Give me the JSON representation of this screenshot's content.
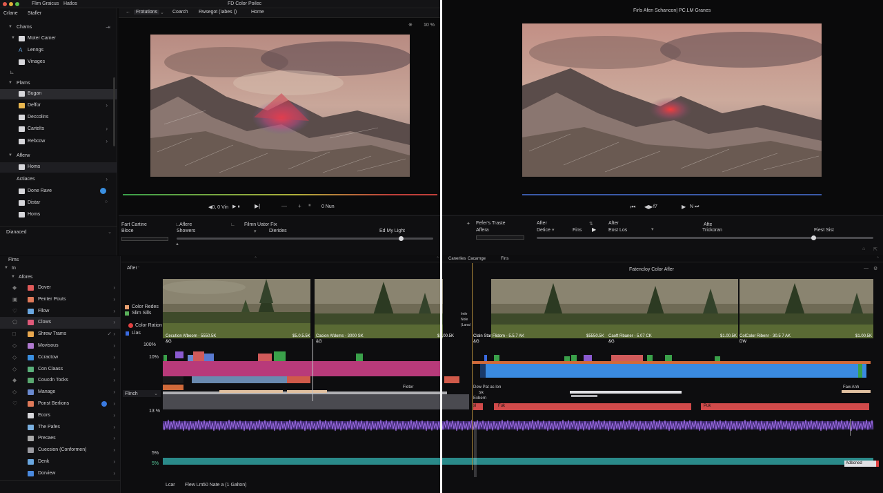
{
  "titlebar": {
    "app_name": "Flim Graicus",
    "menu_1": "Hatlos",
    "title": "FD Color Poilec"
  },
  "toolbar_left": {
    "item_1": "Crlane",
    "item_2": "Stafler",
    "tab_active": "Frotutions",
    "tab_2": "Coarch",
    "tab_3": "Rwsegot (Iabes ()",
    "tab_4": "Home",
    "zoom": "10 %",
    "zoom_prefix": "※"
  },
  "viewer_right": {
    "title": "Firls Afen Schancon| PC.LM Granes"
  },
  "sidebar": {
    "groups": [
      {
        "label": "Chams"
      },
      {
        "label": "Plams"
      },
      {
        "label": "Aflerw"
      },
      {
        "label": "Actiaces"
      }
    ],
    "items": [
      {
        "label": "Moter Camer"
      },
      {
        "label": "Lenngs"
      },
      {
        "label": "Vinages"
      },
      {
        "label": "Bugan"
      },
      {
        "label": "Deffor"
      },
      {
        "label": "Deccolins"
      },
      {
        "label": "Cartelts"
      },
      {
        "label": "Rebcow"
      },
      {
        "label": "Homs"
      },
      {
        "label": "Done Rave"
      },
      {
        "label": "Distar"
      },
      {
        "label": "Homs"
      }
    ],
    "footer": "Dianaced"
  },
  "transport_left": {
    "timecode": "◀0, 0 Vin",
    "end": "0 Nun"
  },
  "transport_right": {
    "frame": "f7"
  },
  "controls_left": {
    "label_1": "Fart Cartine",
    "label_1b": "Bloce",
    "label_2": "Aflere",
    "label_2b": "Showers",
    "label_3": "Filmn Uator Fix",
    "label_3b": "Dierides",
    "label_4": "Ed My Light"
  },
  "controls_right": {
    "label_1": "Fefer's Traste",
    "label_1b": "Affera",
    "label_2": "After",
    "label_2b": "Detice",
    "label_3": "Fins",
    "label_4": "After",
    "label_4b": "Eost Los",
    "label_5": "Afte",
    "label_5b": "Trickoran",
    "label_6": "Fiest Sist"
  },
  "browser": {
    "header": "Flms",
    "sub": "In",
    "group": "Afores",
    "clips": [
      {
        "label": "Dover",
        "color": "#e05a5a"
      },
      {
        "label": "Penter Pouts",
        "color": "#e07a5a"
      },
      {
        "label": "Fllow",
        "color": "#6aa7e0"
      },
      {
        "label": "Clows",
        "color": "#e05a7a"
      },
      {
        "label": "Shrew Trams",
        "color": "#e8a84f"
      },
      {
        "label": "Movisous",
        "color": "#b07ad0"
      },
      {
        "label": "Ccractow",
        "color": "#3a8fe0"
      },
      {
        "label": "Con Claass",
        "color": "#5ab07a"
      },
      {
        "label": "Coucdn Tocks",
        "color": "#5aa870"
      },
      {
        "label": "Manage",
        "color": "#6a8ad0"
      },
      {
        "label": "Ponst Berlions",
        "color": "#e07a5a"
      },
      {
        "label": "Ecors",
        "color": "#d7d7db"
      },
      {
        "label": "The Pafes",
        "color": "#7ab0e0"
      },
      {
        "label": "Precaes",
        "color": "#aaaaaa"
      },
      {
        "label": "Cuecsion (Conformen)",
        "color": "#9a9aa0"
      },
      {
        "label": "Denk",
        "color": "#6aa7e0"
      },
      {
        "label": "Dorview",
        "color": "#4a8ae0"
      }
    ],
    "footer_1": "Lcar",
    "footer_2": "Flew Lm",
    "footer_3": "50 Nate a (1 Galton)"
  },
  "timeline": {
    "header_left": "After",
    "header_right_1": "Canerlies",
    "header_right_2": "Cacarnge",
    "header_right_3": "Flns",
    "title_right": "Fatencloy Color Afler",
    "legend_1": "Color Redes",
    "legend_2": "Slim Sills",
    "legend_3": "Color Ration",
    "legend_4": "Llas",
    "pct_1": "100%",
    "pct_2": "10%",
    "pct_3": "13 %",
    "pct_4": "5%",
    "pct_5": "5%",
    "track_label": "Flinch",
    "clip_1": "Cecution Afboom - 5550.5K",
    "clip_1b": "&G",
    "clip_1v": "$5.0.5.5K",
    "clip_2": "Cacion Afdoms - 3000 SK",
    "clip_2b": "&G",
    "clip_2v": "$1.00.5K",
    "clip_mid_1": "Imle",
    "clip_mid_2": "Nole",
    "clip_mid_3": "(Lanal",
    "clip_3": "Claln Star Flidom - 5.5.7 AK",
    "clip_3b": "&G",
    "clip_3v": "$5550.5K",
    "clip_4": "Caoft Rbaner - 5.07 CK",
    "clip_4b": "&G",
    "clip_4v": "$1.00.5K",
    "clip_5": "ColCalor Ribenr - 30.5 7 AK",
    "clip_5b": "DW",
    "clip_5v": "$1.00.5K",
    "marker_1": "Fleter",
    "marker_2": "Dow Pat as lon",
    "marker_3": "Slk",
    "marker_4": "Exbern",
    "marker_5": "Faw Anh",
    "red_1": "Fuk",
    "red_2": "Puk",
    "red_3": "sl",
    "end_badge": "Adbcned"
  }
}
